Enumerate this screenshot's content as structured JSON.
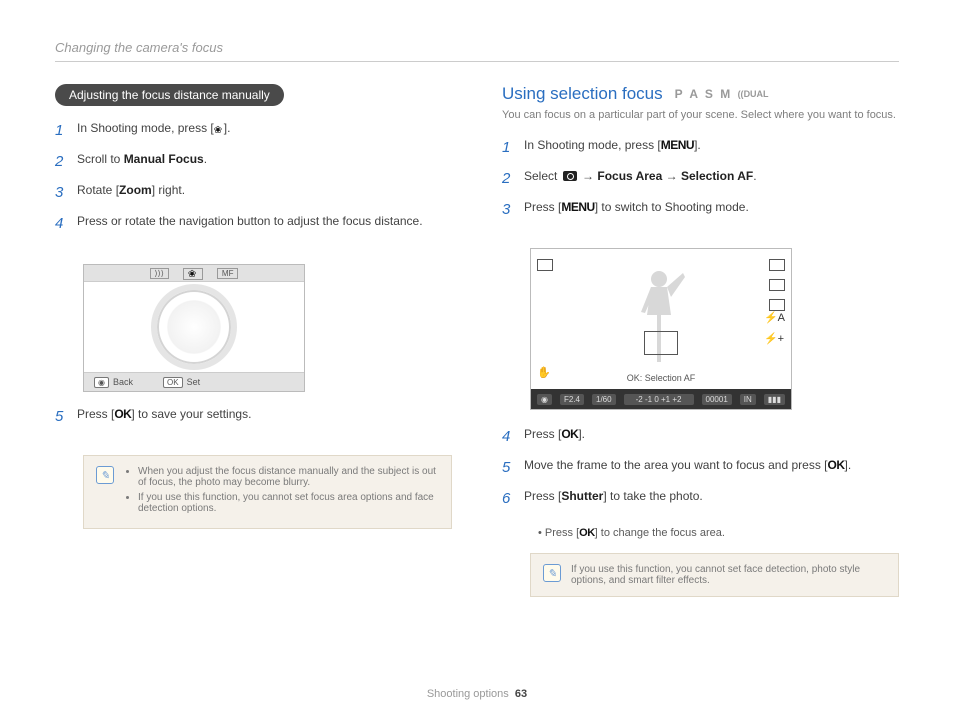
{
  "header": {
    "breadcrumb": "Changing the camera's focus"
  },
  "left": {
    "pill": "Adjusting the focus distance manually",
    "steps": {
      "s1": {
        "num": "1",
        "a": "In Shooting mode, press [",
        "b": "]."
      },
      "s2": {
        "num": "2",
        "a": "Scroll to ",
        "b": "Manual Focus",
        "c": "."
      },
      "s3": {
        "num": "3",
        "a": "Rotate [",
        "b": "Zoom",
        "c": "] right."
      },
      "s4": {
        "num": "4",
        "a": "Press or rotate the navigation button to adjust the focus distance."
      },
      "s5": {
        "num": "5",
        "a": "Press [",
        "b": "OK",
        "c": "] to save your settings."
      }
    },
    "lcd": {
      "back": "Back",
      "set": "Set",
      "ok": "OK",
      "mf": "MF"
    },
    "note": {
      "n1": "When you adjust the focus distance manually and the subject is out of focus, the photo may become blurry.",
      "n2": "If you use this function, you cannot set focus area options and face detection options."
    }
  },
  "right": {
    "title": "Using selection focus",
    "modes": "P A S M",
    "modes_dual": "DUAL",
    "subtext": "You can focus on a particular part of your scene. Select where you want to focus.",
    "steps": {
      "s1": {
        "num": "1",
        "a": "In Shooting mode, press [",
        "b": "MENU",
        "c": "]."
      },
      "s2": {
        "num": "2",
        "a": "Select ",
        "b": " → ",
        "c": "Focus Area",
        "d": " → ",
        "e": "Selection AF",
        "f": "."
      },
      "s3": {
        "num": "3",
        "a": "Press [",
        "b": "MENU",
        "c": "] to switch to Shooting mode."
      },
      "s4": {
        "num": "4",
        "a": "Press [",
        "b": "OK",
        "c": "]."
      },
      "s5": {
        "num": "5",
        "a": "Move the frame to the area you want to focus and press [",
        "b": "OK",
        "c": "]."
      },
      "s6": {
        "num": "6",
        "a": "Press [",
        "b": "Shutter",
        "c": "] to take the photo."
      }
    },
    "sub_bullet": {
      "a": "Press [",
      "b": "OK",
      "c": "] to change the focus area."
    },
    "scene": {
      "ok_sel": "OK: Selection AF",
      "fstop": "F2.4",
      "shutter": "1/60",
      "count": "00001"
    },
    "note": "If you use this function, you cannot set face detection, photo style options, and smart filter effects."
  },
  "footer": {
    "section": "Shooting options",
    "page": "63"
  }
}
